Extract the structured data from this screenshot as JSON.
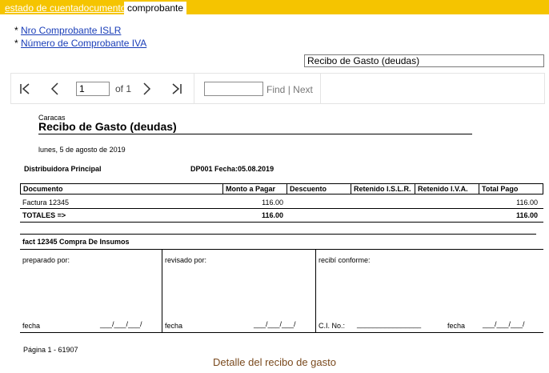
{
  "tabs": [
    "estado de cuenta",
    "documento",
    "comprobante"
  ],
  "links": [
    {
      "star": "*",
      "label": "Nro Comprobante ISLR"
    },
    {
      "star": "*",
      "label": "Número de Comprobante IVA"
    }
  ],
  "report_select": {
    "value": "Recibo de Gasto (deudas)"
  },
  "toolbar": {
    "page_value": "1",
    "of_label": "of 1",
    "find_label": "Find",
    "separator": "|",
    "next_label": "Next"
  },
  "report": {
    "city": "Caracas",
    "title": "Recibo de Gasto (deudas)",
    "date": "lunes, 5 de agosto de 2019",
    "company": "Distribuidora Principal",
    "doc_info": "DP001 Fecha:05.08.2019",
    "columns": [
      "Documento",
      "Monto a Pagar",
      "Descuento",
      "Retenido I.S.L.R.",
      "Retenido I.V.A.",
      "Total Pago"
    ],
    "row": {
      "documento": "Factura 12345",
      "monto": "116.00",
      "total": "116.00"
    },
    "totals": {
      "label": "TOTALES =>",
      "monto": "116.00",
      "total": "116.00"
    },
    "concept": "fact 12345 Compra De Insumos",
    "sign": {
      "prepared": "preparado por:",
      "reviewed": "revisado por:",
      "received": "recibí conforme:",
      "fecha1": "fecha",
      "date1": "___/___/___/",
      "fecha2": "fecha",
      "date2": "___/___/___/",
      "ci": "C.I. No.:",
      "ci_line": "________________",
      "fecha3": "fecha",
      "date3": "___/___/___/"
    },
    "footer": "Página 1 - 61907"
  },
  "caption": "Detalle del recibo de gasto",
  "colors": {
    "tabbar": "#f5c400",
    "link": "#1a3eb8",
    "caption": "#7a4a1e"
  }
}
